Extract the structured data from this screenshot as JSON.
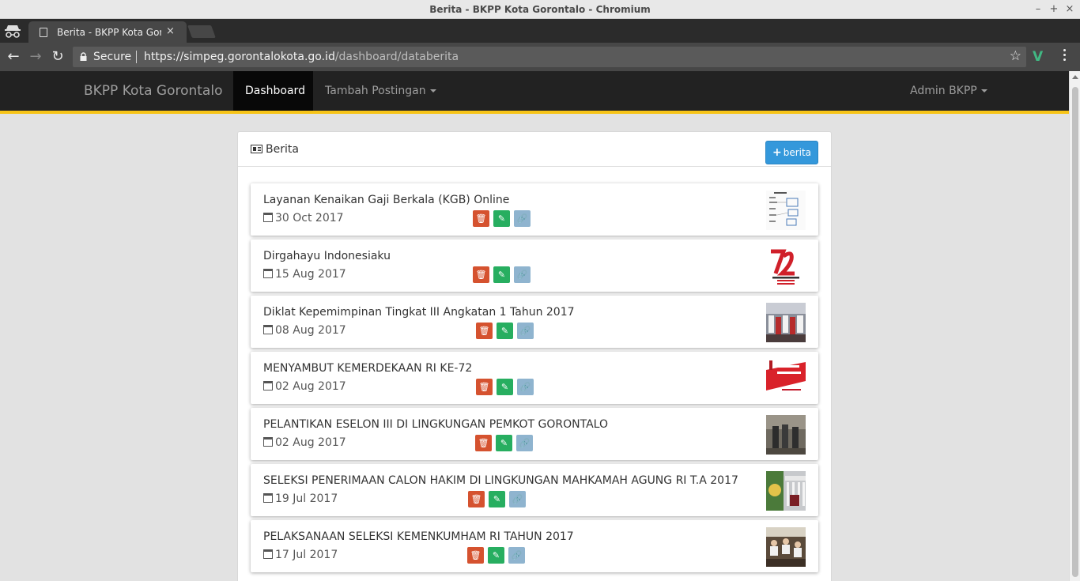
{
  "window": {
    "title": "Berita - BKPP Kota Gorontalo - Chromium"
  },
  "tab": {
    "title": "Berita - BKPP Kota Goro"
  },
  "toolbar": {
    "secure_label": "Secure",
    "url_host": "https://simpeg.gorontalokota.go.id",
    "url_path": "/dashboard/databerita"
  },
  "navbar": {
    "brand": "BKPP Kota Gorontalo",
    "dashboard": "Dashboard",
    "tambah": "Tambah Postingan",
    "admin": "Admin BKPP",
    "accent_color": "#f7c418"
  },
  "panel": {
    "title": "Berita",
    "add_button": "berita"
  },
  "news": [
    {
      "title": "Layanan Kenaikan Gaji Berkala (KGB) Online",
      "date": "30 Oct 2017",
      "thumb": "document"
    },
    {
      "title": "Dirgahayu Indonesiaku",
      "date": "15 Aug 2017",
      "thumb": "72-logo"
    },
    {
      "title": "Diklat Kepemimpinan Tingkat III Angkatan 1 Tahun 2017",
      "date": "08 Aug 2017",
      "thumb": "group-photo"
    },
    {
      "title": "MENYAMBUT KEMERDEKAAN RI KE-72",
      "date": "02 Aug 2017",
      "thumb": "flag-banner"
    },
    {
      "title": "PELANTIKAN ESELON III DI LINGKUNGAN PEMKOT GORONTALO",
      "date": "02 Aug 2017",
      "thumb": "ceremony-photo"
    },
    {
      "title": "SELEKSI PENERIMAAN CALON HAKIM DI LINGKUNGAN MAHKAMAH AGUNG RI T.A 2017",
      "date": "19 Jul 2017",
      "thumb": "court-building"
    },
    {
      "title": "PELAKSANAAN SELEKSI KEMENKUMHAM RI TAHUN 2017",
      "date": "17 Jul 2017",
      "thumb": "exam-room"
    }
  ]
}
